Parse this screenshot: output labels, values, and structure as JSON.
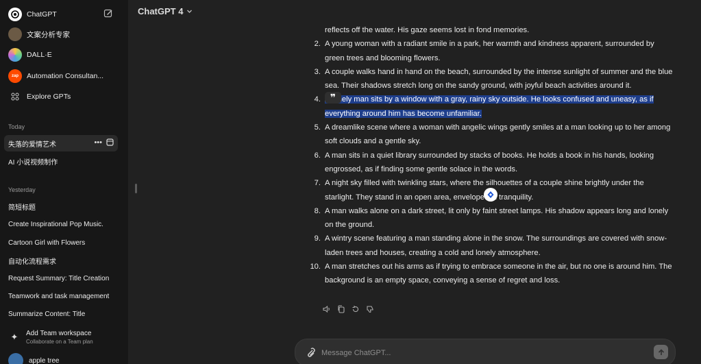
{
  "sidebar": {
    "top_items": [
      {
        "label": "ChatGPT",
        "icon": "chatgpt-logo-icon"
      },
      {
        "label": "文案分析专家",
        "icon": "gpt-avatar-icon"
      },
      {
        "label": "DALL·E",
        "icon": "dalle-icon"
      },
      {
        "label": "Automation Consultan...",
        "icon": "zapier-icon"
      },
      {
        "label": "Explore GPTs",
        "icon": "grid-icon"
      }
    ],
    "section_today": "Today",
    "today_chats": [
      "失落的爱情艺术",
      "AI 小说视频制作"
    ],
    "section_yesterday": "Yesterday",
    "yesterday_chats": [
      "简短标题",
      "Create Inspirational Pop Music.",
      "Cartoon Girl with Flowers",
      "自动化流程需求",
      "Request Summary: Title Creation",
      "Teamwork and task management",
      "Summarize Content: Title"
    ],
    "team": {
      "title": "Add Team workspace",
      "subtitle": "Collaborate on a Team plan"
    },
    "user": {
      "name": "apple tree"
    }
  },
  "header": {
    "model": "ChatGPT 4"
  },
  "conversation": {
    "items": [
      {
        "num": "",
        "text": "reflects off the water. His gaze seems lost in fond memories."
      },
      {
        "num": "2.",
        "text": "A young woman with a radiant smile in a park, her warmth and kindness apparent, surrounded by green trees and blooming flowers."
      },
      {
        "num": "3.",
        "text": "A couple walks hand in hand on the beach, surrounded by the intense sunlight of summer and the blue sea. Their shadows stretch long on the sandy ground, with joyful beach activities around it."
      },
      {
        "num": "4.",
        "text": "A lonely man sits by a window with a gray, rainy sky outside. He looks confused and uneasy, as if everything around him has become unfamiliar.",
        "highlighted": true
      },
      {
        "num": "5.",
        "text": "A dreamlike scene where a woman with angelic wings gently smiles at a man looking up to her among soft clouds and a gentle sky."
      },
      {
        "num": "6.",
        "text": "A man sits in a quiet library surrounded by stacks of books. He holds a book in his hands, looking engrossed, as if finding some gentle solace in the words."
      },
      {
        "num": "7.",
        "text": "A night sky filled with twinkling stars, where the silhouettes of a couple shine brightly under the starlight. They stand in an open area, enveloped in tranquility."
      },
      {
        "num": "8.",
        "text": "A man walks alone on a dark street, lit only by faint street lamps. His shadow appears long and lonely on the ground."
      },
      {
        "num": "9.",
        "text": "A wintry scene featuring a man standing alone in the snow. The surroundings are covered with snow-laden trees and houses, creating a cold and lonely atmosphere."
      },
      {
        "num": "10.",
        "text": "A man stretches out his arms as if trying to embrace someone in the air, but no one is around him. The background is an empty space, conveying a sense of regret and loss."
      }
    ],
    "quote_button": "❞"
  },
  "composer": {
    "placeholder": "Message ChatGPT..."
  },
  "colors": {
    "sidebar_bg": "#171717",
    "main_bg": "#212121",
    "highlight": "#1e3e8c",
    "text": "#ececec"
  }
}
